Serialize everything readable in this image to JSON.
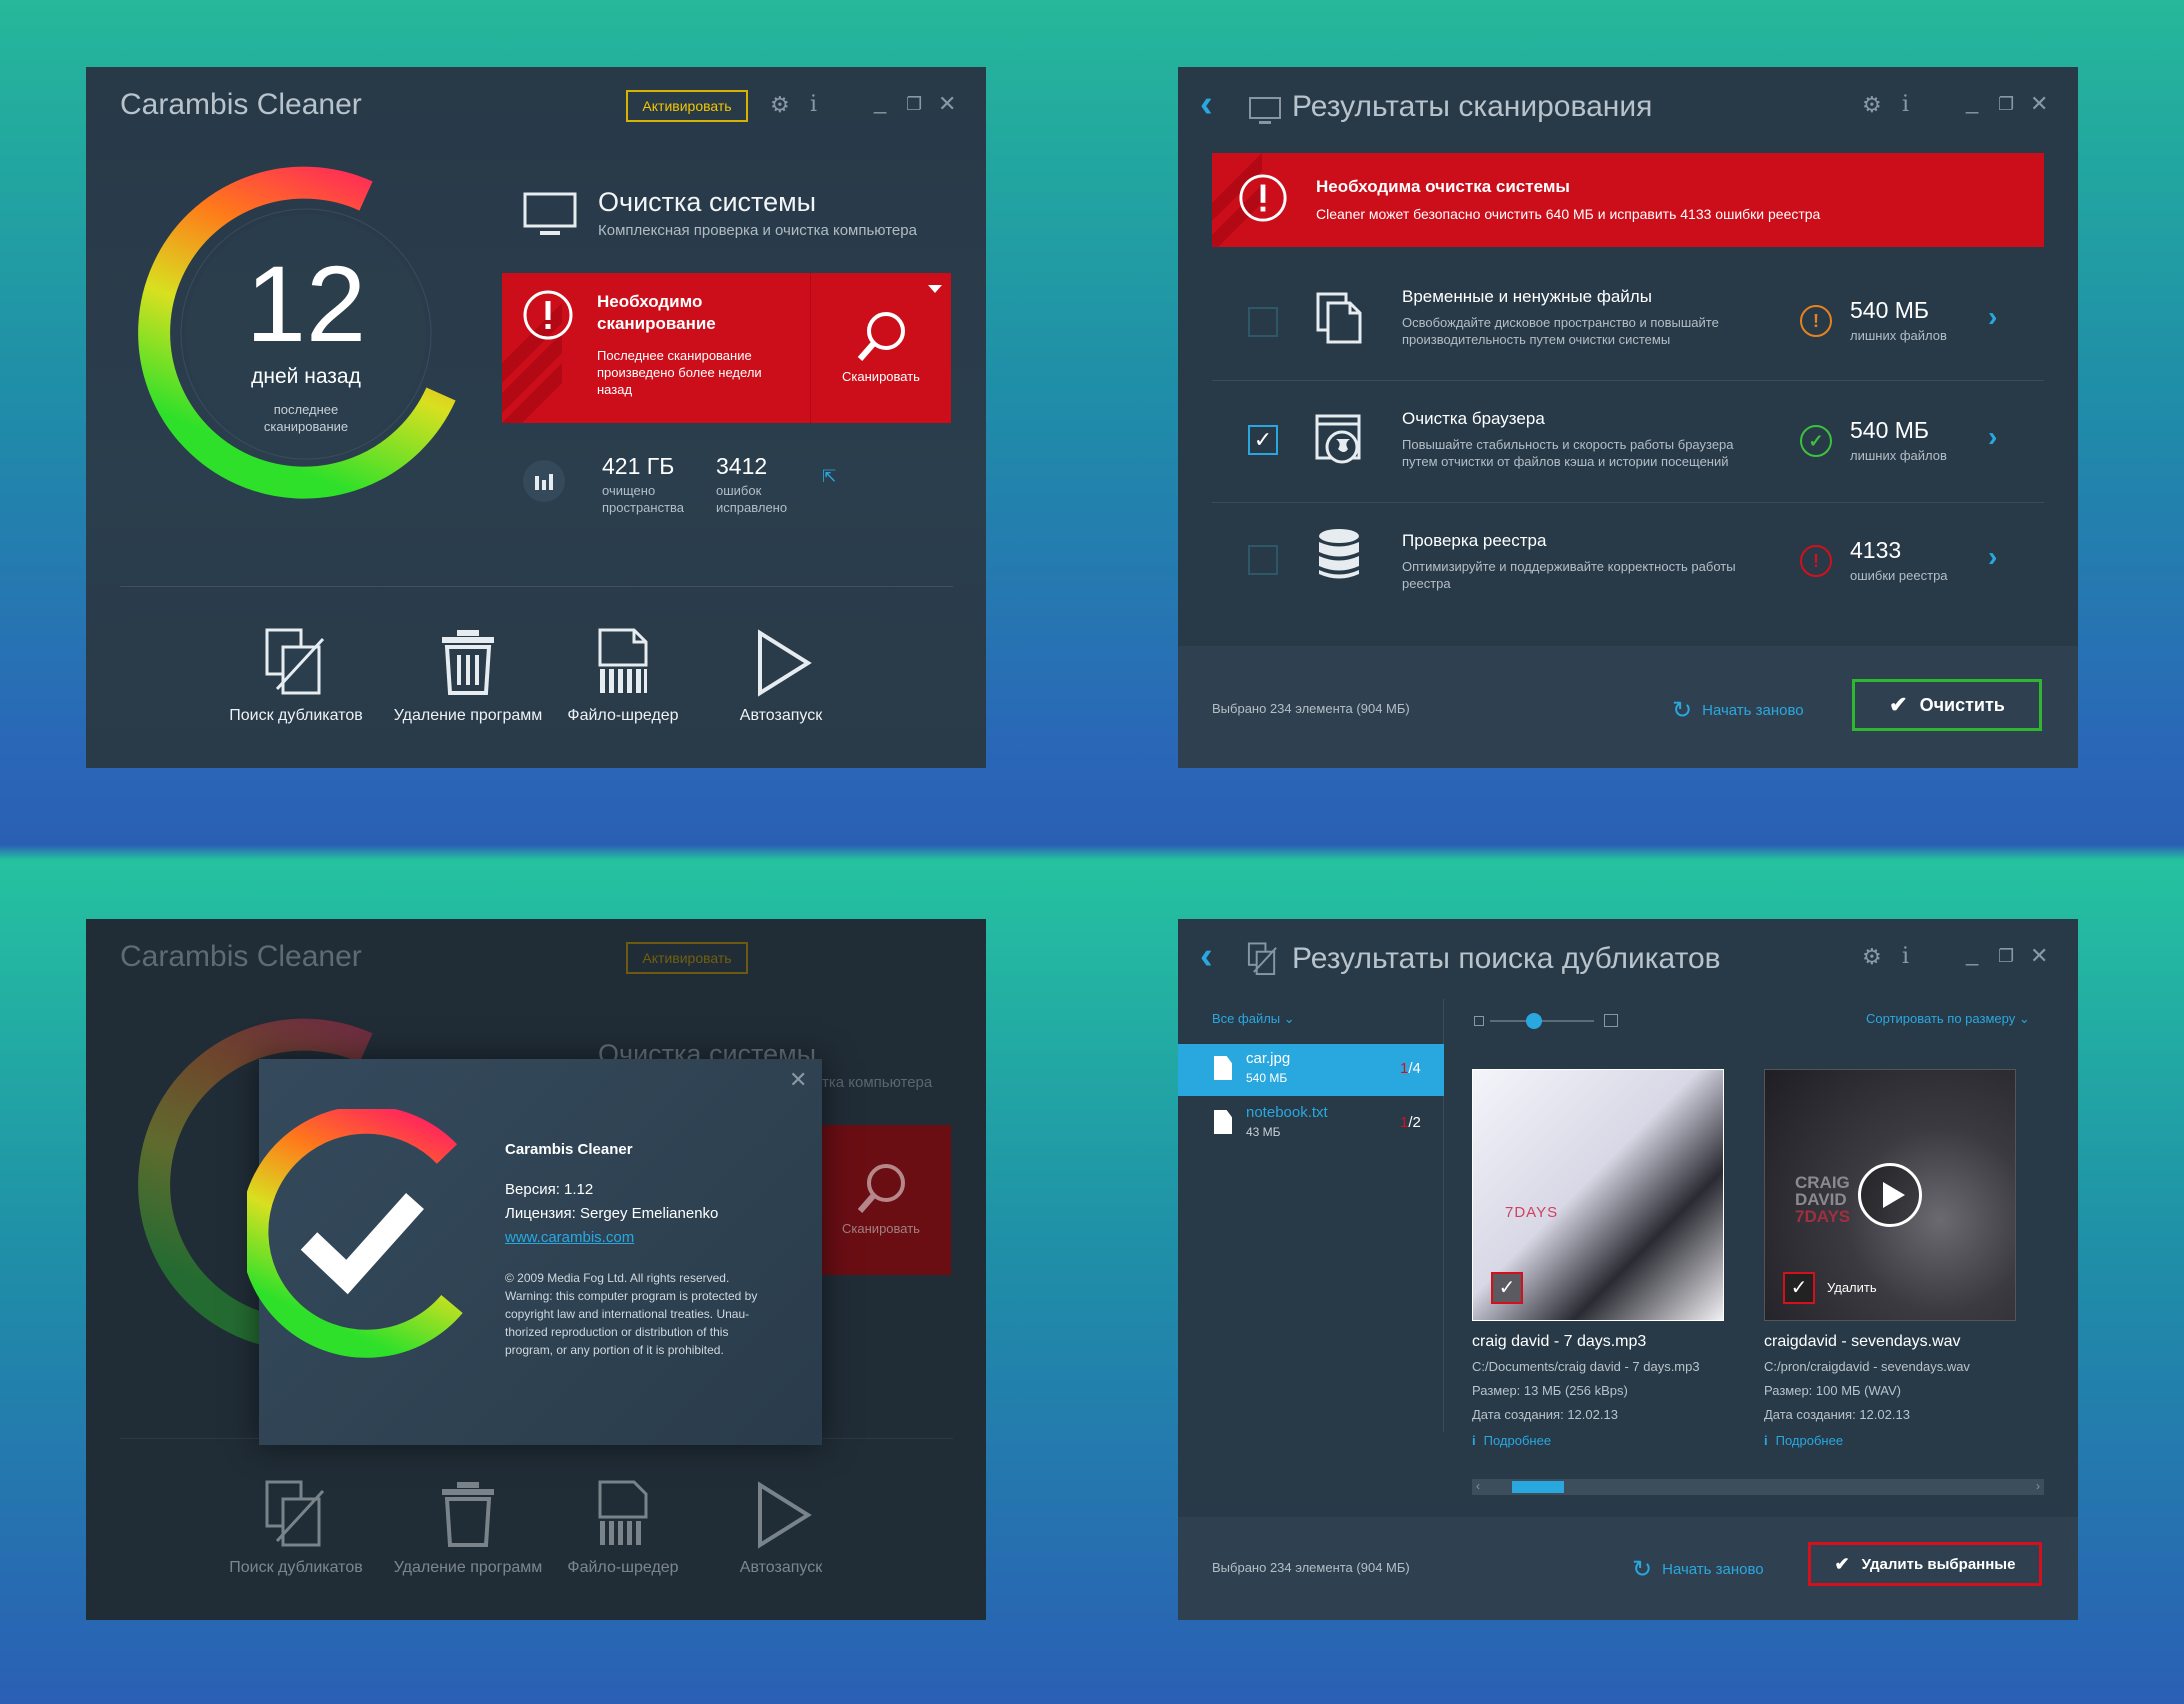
{
  "win1": {
    "title": "Carambis Cleaner",
    "activate": "Активировать",
    "counter": "12",
    "counter_unit": "дней назад",
    "counter_sub": "последнее\nсканирование",
    "section_title": "Очистка системы",
    "section_sub": "Комплексная проверка и очистка компьютера",
    "alert_title": "Необходимо\nсканирование",
    "alert_text": "Последнее сканирование произведено более недели назад",
    "scan_label": "Сканировать",
    "stat1_value": "421 ГБ",
    "stat1_label": "очищено\nпространства",
    "stat2_value": "3412",
    "stat2_label": "ошибок\nисправлено",
    "tools": [
      {
        "label": "Поиск дубликатов",
        "icon": "duplicate-search-icon"
      },
      {
        "label": "Удаление программ",
        "icon": "trash-icon"
      },
      {
        "label": "Файло-шредер",
        "icon": "shredder-icon"
      },
      {
        "label": "Автозапуск",
        "icon": "play-icon"
      }
    ]
  },
  "win2": {
    "title": "Результаты сканирования",
    "alert_title": "Необходима очистка системы",
    "alert_text": "Cleaner может безопасно очистить 640 МБ и исправить 4133 ошибки реестра",
    "items": [
      {
        "title": "Временные и ненужные файлы",
        "desc1": "Освобождайте дисковое пространство и повышайте",
        "desc2": "производительность путем очистки системы",
        "value": "540 МБ",
        "unit": "лишних файлов",
        "checked": false,
        "status": "warning",
        "status_color": "#e8821e"
      },
      {
        "title": "Очистка браузера",
        "desc1": "Повышайте стабильность и скорость работы браузера",
        "desc2": "путем отчистки от файлов кэша и истории посещений",
        "value": "540 МБ",
        "unit": "лишних файлов",
        "checked": true,
        "status": "ok",
        "status_color": "#3cc23c"
      },
      {
        "title": "Проверка реестра",
        "desc1": "Оптимизируйте и поддерживайте корректность работы",
        "desc2": "реестра",
        "value": "4133",
        "unit": "ошибки реестра",
        "checked": false,
        "status": "error",
        "status_color": "#d4101c"
      }
    ],
    "selected": "Выбрано 234 элемента (904 МБ)",
    "restart": "Начать заново",
    "clean": "Очистить"
  },
  "win3": {
    "title": "Carambis Cleaner",
    "activate": "Активировать",
    "bg_section_title": "Очистка системы",
    "bg_section_sub": "тка компьютера",
    "scan_label": "Сканировать",
    "dialog": {
      "product": "Carambis Cleaner",
      "version": "Версия: 1.12",
      "license": "Лицензия: Sergey Emelianenko",
      "url": "www.carambis.com",
      "legal": [
        "© 2009 Media Fog Ltd. All rights reserved.",
        "Warning: this computer program is protected by",
        "copyright law and international treaties. Unau-",
        "thorized reproduction or distribution of this",
        "program, or any portion of it is prohibited."
      ]
    },
    "tools": [
      "Поиск дубликатов",
      "Удаление программ",
      "Файло-шредер",
      "Автозапуск"
    ]
  },
  "win4": {
    "title": "Результаты поиска дубликатов",
    "filter": "Все файлы",
    "sort": "Сортировать по размеру",
    "files": [
      {
        "name": "car.jpg",
        "size": "540 МБ",
        "count_a": "1",
        "count_b": "/4",
        "selected": true
      },
      {
        "name": "notebook.txt",
        "size": "43 МБ",
        "count_a": "1",
        "count_b": "/2",
        "selected": false
      }
    ],
    "cards": [
      {
        "name": "craig david - 7 days.mp3",
        "path": "C:/Documents/craig david - 7 days.mp3",
        "size": "Размер: 13 МБ (256 kBps)",
        "date": "Дата создания: 12.02.13",
        "more": "Подробнее",
        "cover_text": "7DAYS",
        "checked": true
      },
      {
        "name": "craigdavid - sevendays.wav",
        "path": "C:/pron/craigdavid - sevendays.wav",
        "size": "Размер: 100 МБ (WAV)",
        "date": "Дата создания: 12.02.13",
        "more": "Подробнее",
        "cover_text1": "CRAIG",
        "cover_text2": "DAVID",
        "cover_text3": "7DAYS",
        "delete_label": "Удалить",
        "checked": true
      }
    ],
    "selected": "Выбрано 234 элемента (904 МБ)",
    "restart": "Начать заново",
    "delete": "Удалить выбранные"
  },
  "colors": {
    "accent": "#29a8e0",
    "alert": "#d0101c",
    "window": "#283a48",
    "ok": "#3cc23c",
    "warning": "#e8821e"
  }
}
